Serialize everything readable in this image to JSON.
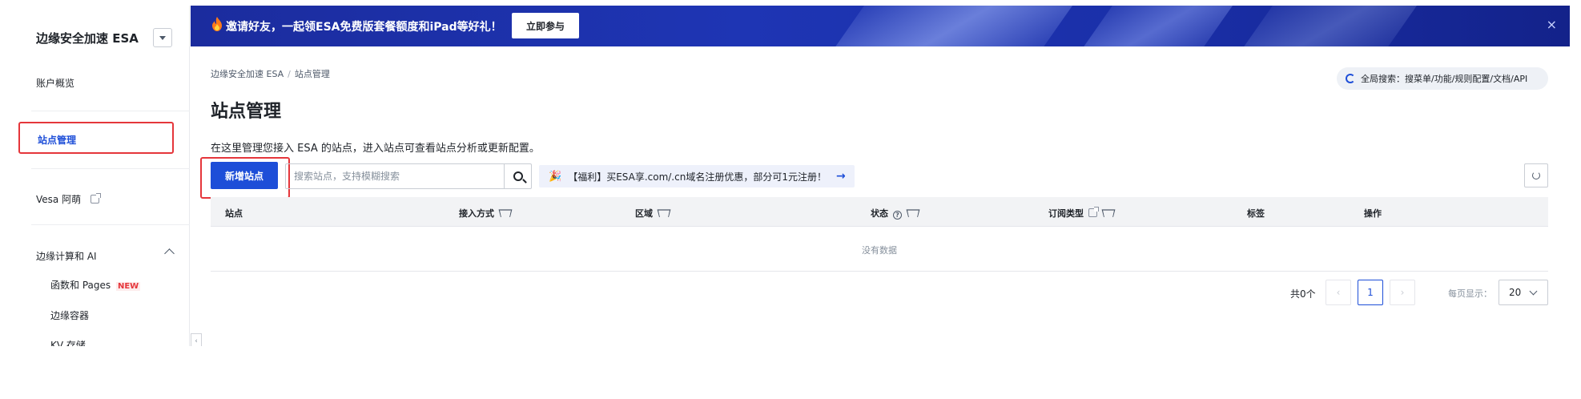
{
  "sidebar": {
    "product_name": "边缘安全加速 ESA",
    "items": [
      {
        "label": "账户概览"
      },
      {
        "label": "站点管理"
      },
      {
        "label": "Vesa 阿萌"
      },
      {
        "label": "边缘计算和 AI"
      }
    ],
    "sub_items": [
      {
        "label": "函数和 Pages",
        "badge": "NEW"
      },
      {
        "label": "边缘容器"
      },
      {
        "label": "KV 存储"
      }
    ]
  },
  "banner": {
    "text": "邀请好友，一起领ESA免费版套餐额度和iPad等好礼！",
    "button": "立即参与",
    "close": "×"
  },
  "breadcrumb": [
    "边缘安全加速 ESA",
    "站点管理"
  ],
  "page_title": "站点管理",
  "global_search": "全局搜索：搜菜单/功能/规则配置/文档/API",
  "description": "在这里管理您接入 ESA 的站点，进入站点可查看站点分析或更新配置。",
  "toolbar": {
    "add_label": "新增站点",
    "search_placeholder": "搜索站点，支持模糊搜索",
    "promo": "【福利】买ESA享.com/.cn域名注册优惠，部分可1元注册！",
    "promo_arrow": "→"
  },
  "table": {
    "columns": [
      "站点",
      "接入方式",
      "区域",
      "状态",
      "订阅类型",
      "标签",
      "操作"
    ],
    "empty_text": "没有数据"
  },
  "pagination": {
    "total": "共0个",
    "current_page": "1",
    "prev": "‹",
    "next": "›",
    "per_page_label": "每页显示：",
    "per_page": "20"
  },
  "colors": {
    "accent": "#1d4ed8",
    "highlight_box": "#e5363b",
    "banner_bg": "#1e35b4"
  }
}
